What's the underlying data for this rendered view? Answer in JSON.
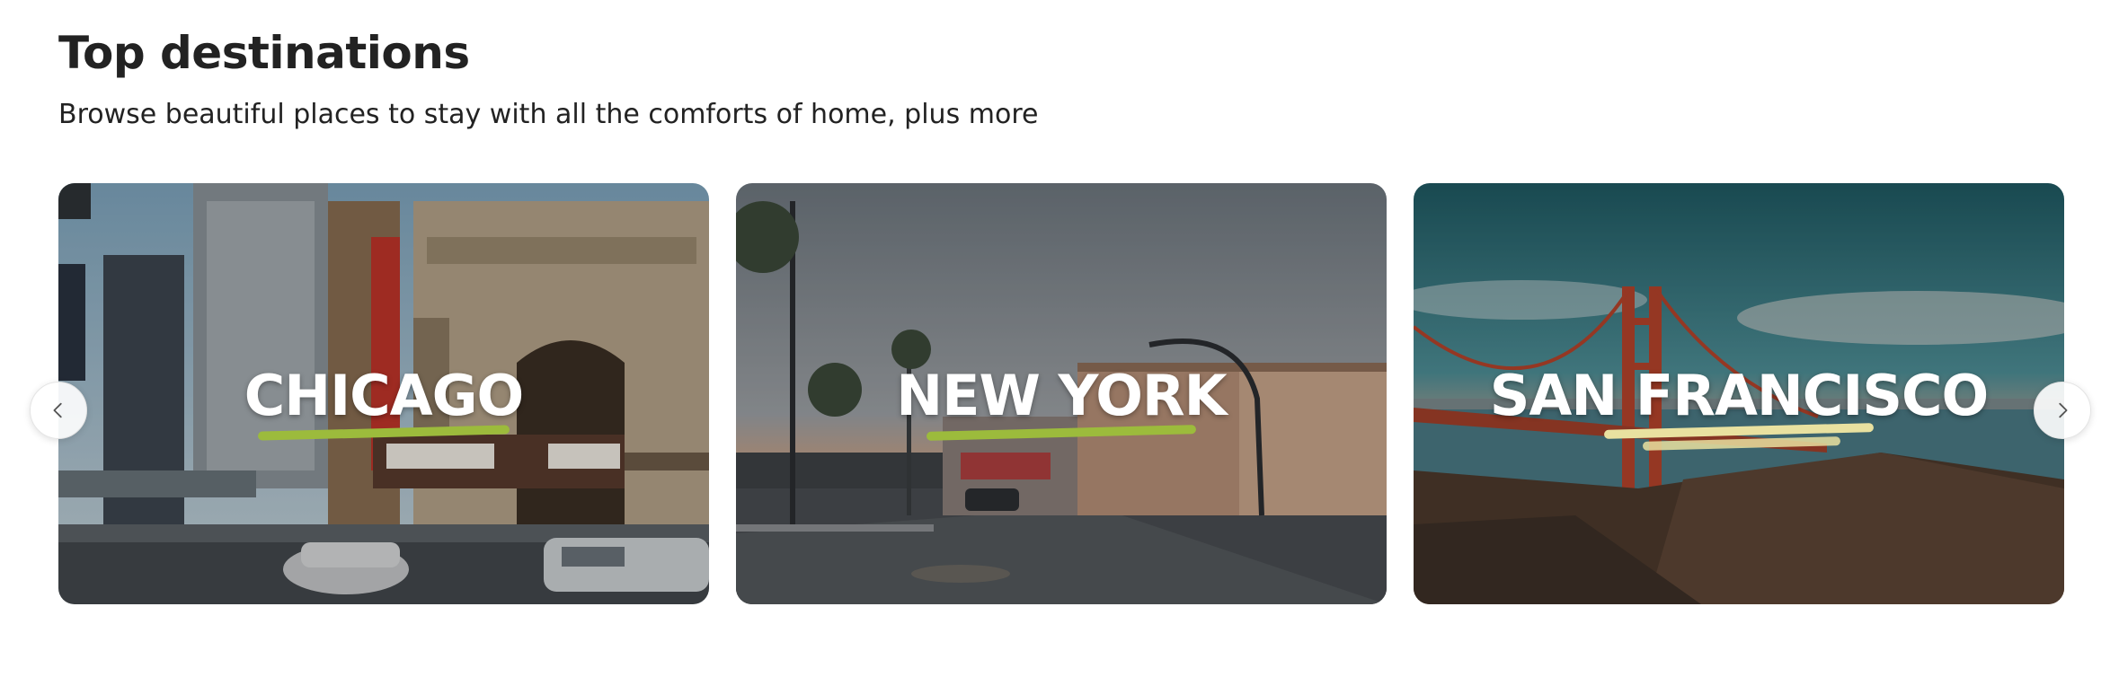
{
  "section": {
    "title": "Top destinations",
    "subtitle": "Browse beautiful places to stay with all the comforts of home, plus more"
  },
  "cards": [
    {
      "label": "CHICAGO",
      "accent": "#9cbb3c"
    },
    {
      "label": "NEW YORK",
      "accent": "#9cbb3c"
    },
    {
      "label": "SAN FRANCISCO",
      "accent": "#e9e1a0"
    }
  ],
  "nav": {
    "prev_icon": "chevron-left-icon",
    "next_icon": "chevron-right-icon"
  }
}
